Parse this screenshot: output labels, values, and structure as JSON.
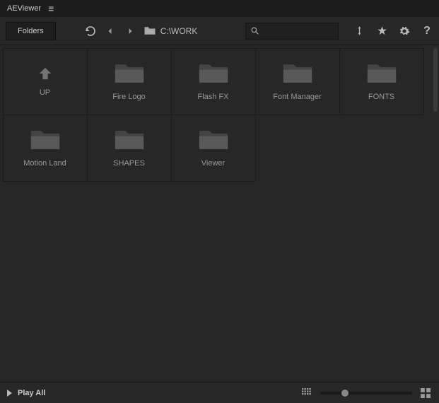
{
  "titlebar": {
    "app_name": "AEViewer"
  },
  "toolbar": {
    "folders_label": "Folders",
    "path": "C:\\WORK",
    "search_placeholder": ""
  },
  "items": [
    {
      "type": "up",
      "label": "UP"
    },
    {
      "type": "folder",
      "label": "Fire Logo"
    },
    {
      "type": "folder",
      "label": "Flash FX"
    },
    {
      "type": "folder",
      "label": "Font Manager"
    },
    {
      "type": "folder",
      "label": "FONTS"
    },
    {
      "type": "folder",
      "label": "Motion Land"
    },
    {
      "type": "folder",
      "label": "SHAPES"
    },
    {
      "type": "folder",
      "label": "Viewer"
    }
  ],
  "footer": {
    "play_all_label": "Play All",
    "zoom_percent": 25
  },
  "colors": {
    "folder_back": "#444444",
    "folder_front": "#595959"
  }
}
